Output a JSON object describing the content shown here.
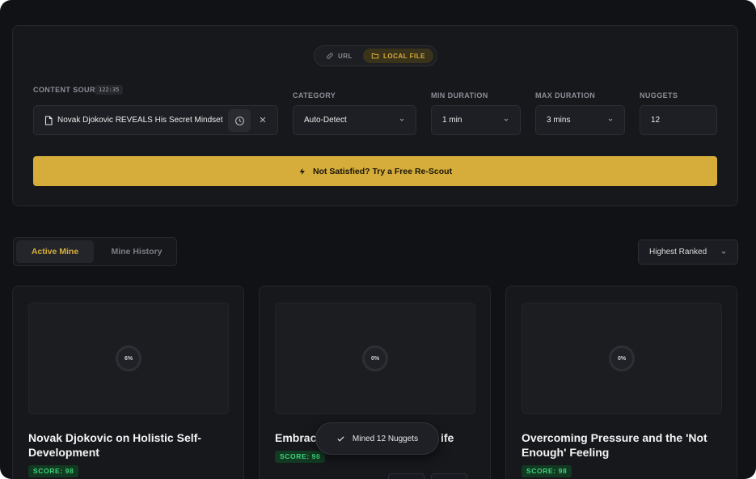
{
  "source_toggle": {
    "url_label": "URL",
    "local_label": "LOCAL FILE"
  },
  "content_source": {
    "label": "CONTENT SOURCE",
    "duration_chip": "122:35",
    "value": "Novak Djokovic REVEALS His Secret Mindset"
  },
  "category": {
    "label": "CATEGORY",
    "value": "Auto-Detect"
  },
  "min_duration": {
    "label": "MIN DURATION",
    "value": "1 min"
  },
  "max_duration": {
    "label": "MAX DURATION",
    "value": "3 mins"
  },
  "nuggets": {
    "label": "NUGGETS",
    "value": "12"
  },
  "rescout_button": {
    "label": "Not Satisfied? Try a Free Re-Scout"
  },
  "tabs": [
    {
      "label": "Active Mine"
    },
    {
      "label": "Mine History"
    }
  ],
  "sort": {
    "value": "Highest Ranked"
  },
  "cards": [
    {
      "progress": "6%",
      "title": "Novak Djokovic on Holistic Self-Development",
      "score": "SCORE: 98"
    },
    {
      "progress": "0%",
      "title": "Embrac",
      "title_tail": "ife",
      "score": "SCORE: 98"
    },
    {
      "progress": "0%",
      "title": "Overcoming Pressure and the 'Not Enough' Feeling",
      "score": "SCORE: 98"
    }
  ],
  "toast": {
    "message": "Mined 12 Nuggets"
  },
  "colors": {
    "accent": "#d6ad3b",
    "background": "#111216",
    "score_green": "#3fd47c"
  }
}
